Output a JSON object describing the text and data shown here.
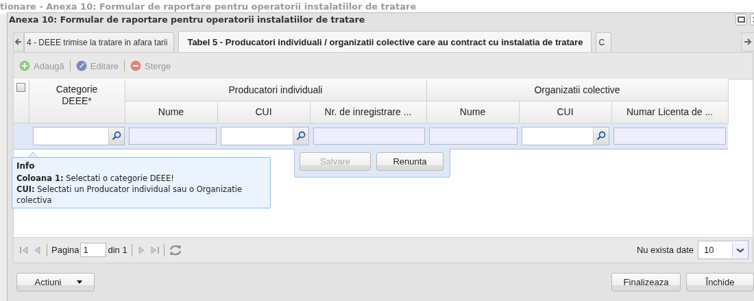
{
  "background_window": {
    "title": "tionare - Anexa 10: Formular de raportare pentru operatorii instalatiilor de tratare"
  },
  "window": {
    "title": "Anexa 10: Formular de raportare pentru operatorii instalatiilor de tratare"
  },
  "tabs": [
    {
      "label": "4 - DEEE trimise la tratare in afara tarii",
      "selected": false
    },
    {
      "label": "Tabel 5 - Producatori individuali / organizatii colective care au contract cu instalatia de tratare",
      "selected": true
    },
    {
      "label": "C",
      "selected": false
    }
  ],
  "toolbar": [
    {
      "label": "Adaugă",
      "kind": "add",
      "disabled": true
    },
    {
      "label": "Editare",
      "kind": "edit",
      "disabled": true
    },
    {
      "label": "Sterge",
      "kind": "delete",
      "disabled": true
    }
  ],
  "grid": {
    "select_all_checked": false,
    "first_column": "Categorie DEEE*",
    "groups": [
      {
        "label": "Producatori individuali",
        "columns": [
          "Nume",
          "CUI",
          "Nr. de inregistrare ..."
        ]
      },
      {
        "label": "Organizatii colective",
        "columns": [
          "Nume",
          "CUI",
          "Numar Licenta de ..."
        ]
      }
    ],
    "editor_fields": [
      {
        "kind": "lookup"
      },
      {
        "kind": "readonly"
      },
      {
        "kind": "lookup"
      },
      {
        "kind": "readonly"
      },
      {
        "kind": "readonly"
      },
      {
        "kind": "lookup"
      },
      {
        "kind": "readonly"
      }
    ]
  },
  "row_editor": {
    "buttons": [
      {
        "label": "Salvare",
        "disabled": true
      },
      {
        "label": "Renunta",
        "disabled": false
      }
    ]
  },
  "tooltip": {
    "title": "Info",
    "lines": [
      "**Coloana 1:** Selectati o categorie DEEE!",
      "**CUI:** Selectati un Producator individual sau o Organizatie colectiva"
    ]
  },
  "paging": {
    "page_label": "Pagina",
    "page": "1",
    "of_label": "din 1",
    "status": "Nu exista date",
    "page_size": "10"
  },
  "footer": {
    "actions_button": "Actiuni",
    "buttons": [
      "Finalizeaza",
      "Închide"
    ]
  }
}
